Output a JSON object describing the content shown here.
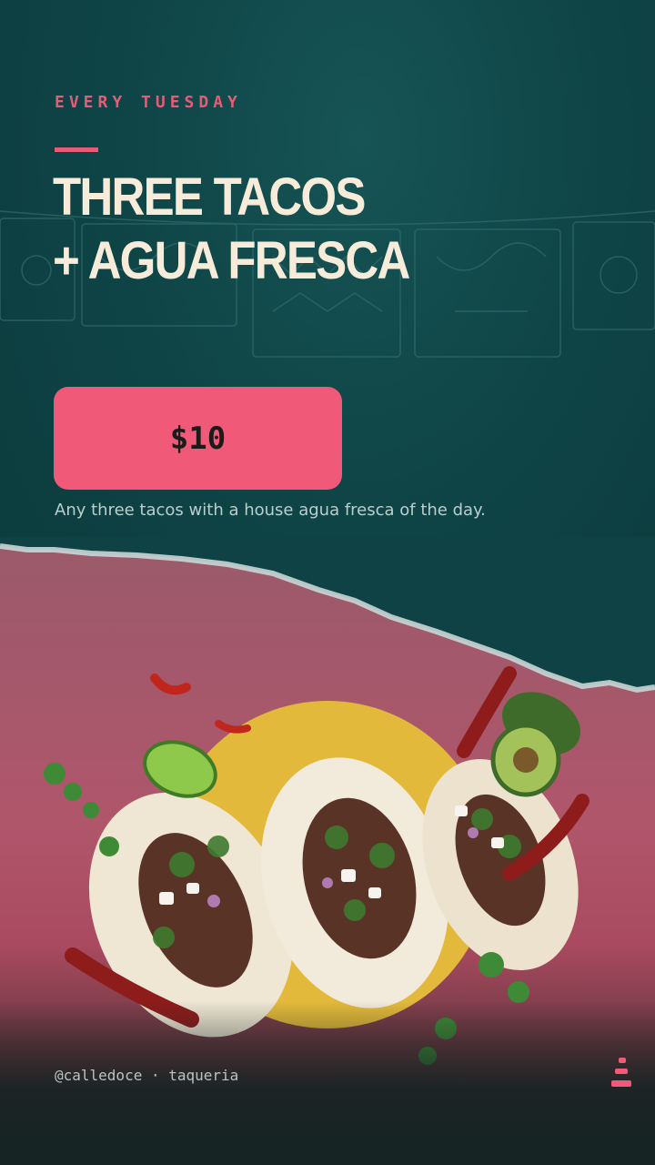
{
  "promo": {
    "kicker": "EVERY TUESDAY",
    "headline_line1": "THREE TACOS",
    "headline_line2": "+ AGUA FRESCA",
    "price": "$10",
    "description": "Any three tacos with a house agua fresca of the day."
  },
  "footer": {
    "handle": "@calledoce · taqueria"
  },
  "colors": {
    "teal": "#0f4547",
    "accent_pink": "#f05a78",
    "cream": "#f6ecd9",
    "mustard": "#e2b93a"
  },
  "icons": [
    "papel-picado-banner",
    "brand-logo-icon",
    "taco-illustration"
  ]
}
